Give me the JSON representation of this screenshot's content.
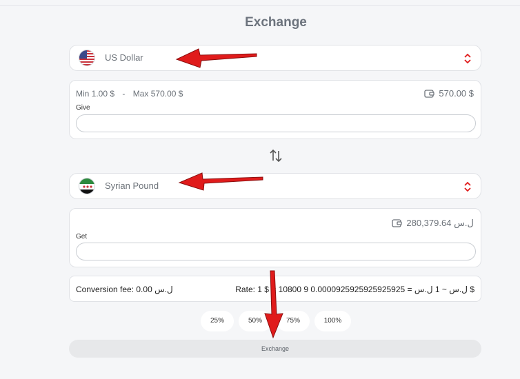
{
  "page": {
    "title": "Exchange"
  },
  "from": {
    "currency_label": "US Dollar",
    "flag_icon": "us-flag-icon",
    "min_label": "Min 1.00 $",
    "separator": "-",
    "max_label": "Max 570.00 $",
    "balance": "570.00 $",
    "field_label": "Give",
    "value": ""
  },
  "to": {
    "currency_label": "Syrian Pound",
    "flag_icon": "syria-flag-icon",
    "balance": "ل.س 280,379.64",
    "field_label": "Get",
    "value": ""
  },
  "info": {
    "fee": "Conversion fee: 0.00 ل.س",
    "rate": "Rate: 1 $ = 10800 ل.س ~ 1 ل.س = 0.0000925925925925925 9 $"
  },
  "percent_buttons": [
    "25%",
    "50%",
    "75%",
    "100%"
  ],
  "exchange_button": "Exchange",
  "colors": {
    "accent_red": "#e01b1b",
    "muted_text": "#6b7178"
  }
}
